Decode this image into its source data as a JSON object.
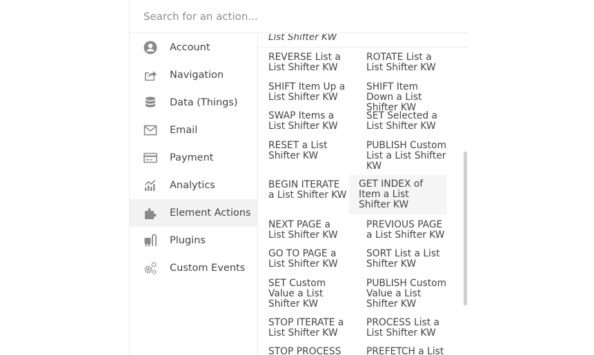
{
  "search": {
    "placeholder": "Search for an action..."
  },
  "categories": [
    {
      "label": "Account",
      "icon": "account-icon"
    },
    {
      "label": "Navigation",
      "icon": "navigation-icon"
    },
    {
      "label": "Data (Things)",
      "icon": "database-icon"
    },
    {
      "label": "Email",
      "icon": "email-icon"
    },
    {
      "label": "Payment",
      "icon": "payment-icon"
    },
    {
      "label": "Analytics",
      "icon": "analytics-icon"
    },
    {
      "label": "Element Actions",
      "icon": "puzzle-icon",
      "active": true
    },
    {
      "label": "Plugins",
      "icon": "plug-icon"
    },
    {
      "label": "Custom Events",
      "icon": "gears-icon"
    }
  ],
  "actions": {
    "group_title": "List Shifter KW",
    "items": [
      "REVERSE List a List Shifter KW",
      "ROTATE List a List Shifter KW",
      "SHIFT Item Up a List Shifter KW",
      "SHIFT Item Down a List Shifter KW",
      "SWAP Items a List Shifter KW",
      "SET Selected a List Shifter KW",
      "RESET a List Shifter KW",
      "PUBLISH Custom List a List Shifter KW",
      "BEGIN ITERATE a List Shifter KW",
      "GET INDEX of Item a List Shifter KW",
      "NEXT PAGE a List Shifter KW",
      "PREVIOUS PAGE a List Shifter KW",
      "GO TO PAGE a List Shifter KW",
      "SORT List a List Shifter KW",
      "SET Custom Value a List Shifter KW",
      "PUBLISH Custom Value a List Shifter KW",
      "STOP ITERATE a List Shifter KW",
      "PROCESS List a List Shifter KW",
      "STOP PROCESS a List Shifter KW",
      "PREFETCH a List Shifter KW"
    ]
  },
  "colors": {
    "icon": "#8a8a8a",
    "text": "#444444",
    "active_bg": "#f2f2f2",
    "scrollbar": "#cfcfcf"
  }
}
